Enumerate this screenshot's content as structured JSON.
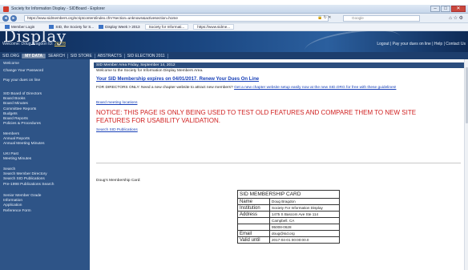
{
  "browser": {
    "title": "Society for Information Display - SIDBoard - Explorer",
    "url": "https://www.sidmembers.org/scriptcontent/index.cfm?section=unknown&activesection=home",
    "search_placeholder": "Google",
    "favorites": [
      {
        "label": "Member Login"
      },
      {
        "label": "SID, the Society for S..."
      },
      {
        "label": "Display Week > 2013"
      },
      {
        "label": "Society for Informati..."
      },
      {
        "label": "https://www.sidme..."
      }
    ]
  },
  "site": {
    "logo": "Display",
    "welcome": "Welcome: Doug Bragdon",
    "id_label": "ID:",
    "id_value": "20778",
    "toplinks": "Logout | Pay your dues on line | Help | Contact Us",
    "tabs": [
      "SID.ORG",
      "MY DATA",
      "SEARCH",
      "SID STORE",
      "ABSTRACTS",
      "SID ELECTION 2011"
    ],
    "active_tab": "MY DATA"
  },
  "sidebar": {
    "group1": [
      "Welcome",
      "Change Your Password"
    ],
    "group2": [
      "Pay your dues on line"
    ],
    "group3": [
      "SID Board of Directors",
      "Board Books",
      "Board Minutes",
      "Committee Reports",
      "Budgets",
      "Board Reports",
      "Policies & Procedures"
    ],
    "group4": [
      "Members",
      "Annual Reports",
      "Annual Meeting Minutes"
    ],
    "group5": [
      "UKI Past",
      "Meeting Minutes"
    ],
    "group6": [
      "Search",
      "Search Member Directory",
      "Search SID Publications",
      "Pre-1998 Publications Search"
    ],
    "group7": [
      "Senior Member Grade",
      "Information",
      "Application",
      "Reference Form"
    ]
  },
  "content": {
    "section_bar": "SID Member Area      Friday, September 14, 2012",
    "welcome_line": "Welcome to the Society for Information Display Members Area.",
    "membership_expires": "Your SID Membership expires on 04/01/2017. Renew Your Dues On Line",
    "directors_text": "FOR DIRECTORS ONLY: Need a new chapter website to attract new members?",
    "directors_link": "Get a new chapter website setup easily now at the new SID.ORG for free with these guidelines!",
    "board_meeting": "Board meeting locations",
    "notice": "NOTICE: THIS PAGE IS ONLY BEING USED TO TEST OLD FEATURES AND COMPARE THEM TO NEW SITE FEATURES FOR USABILITY VALIDATION.",
    "search_pubs": "Search SID Publications",
    "card_label": "Doug's Membership Card:"
  },
  "card": {
    "title": "SID MEMBERSHIP CARD",
    "rows": [
      {
        "k": "Name",
        "v": "Doug Bragdon"
      },
      {
        "k": "Institution",
        "v": "Society For Information Display"
      },
      {
        "k": "Address",
        "v": "1475 S Bascom Ave Ste 114"
      },
      {
        "k": "",
        "v": "Campbell, CA"
      },
      {
        "k": "",
        "v": "95008-0628"
      },
      {
        "k": "Email",
        "v": "doug@sid.org"
      },
      {
        "k": "Valid until",
        "v": "2017-04-01 00:00:00.0"
      }
    ]
  }
}
